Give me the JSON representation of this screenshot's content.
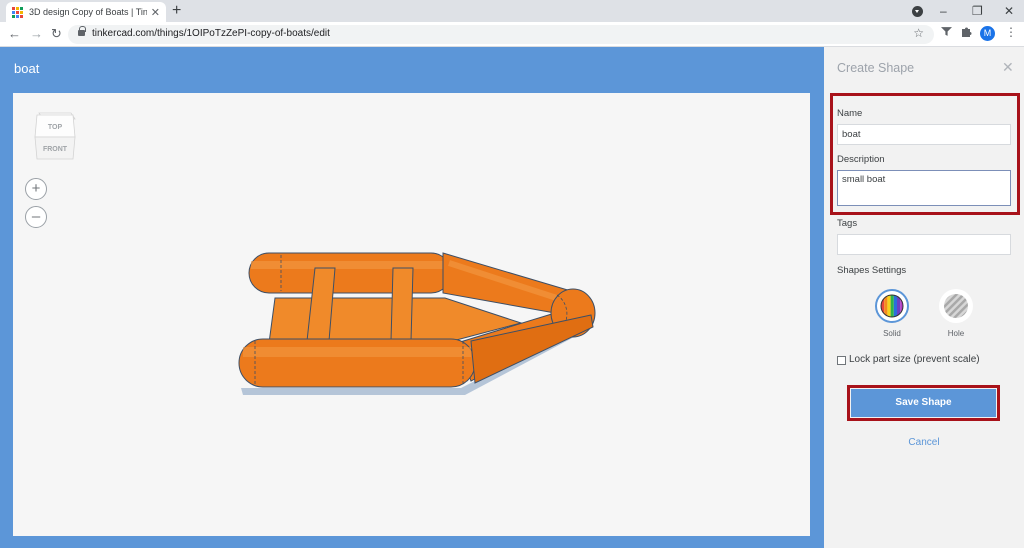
{
  "browser": {
    "tab_title": "3D design Copy of Boats | Tinkercad",
    "tab_close": "✕",
    "new_tab": "+",
    "url": "tinkercad.com/things/1OIPoTzZePI-copy-of-boats/edit",
    "window_controls": {
      "minimize": "–",
      "restore": "❐",
      "close": "✕"
    },
    "profile_initial": "M",
    "nav": {
      "back": "←",
      "forward": "→",
      "reload": "↻"
    },
    "star": "☆",
    "menu": "⋮"
  },
  "editor": {
    "design_name": "boat",
    "viewcube": {
      "top": "TOP",
      "front": "FRONT"
    },
    "zoom_in": "+",
    "zoom_out": "–"
  },
  "panel": {
    "title": "Create Shape",
    "close": "✕",
    "name_label": "Name",
    "name_value": "boat",
    "description_label": "Description",
    "description_value": "small boat",
    "tags_label": "Tags",
    "tags_value": "",
    "settings_label": "Shapes Settings",
    "solid_label": "Solid",
    "hole_label": "Hole",
    "lock_label": "Lock part size (prevent scale)",
    "lock_checked": false,
    "save_label": "Save Shape",
    "cancel_label": "Cancel"
  },
  "colors": {
    "workspace_blue": "#5c96d8",
    "highlight_red": "#a8121a",
    "boat_orange": "#ec7a1c",
    "panel_bg": "#f2f2f2"
  }
}
